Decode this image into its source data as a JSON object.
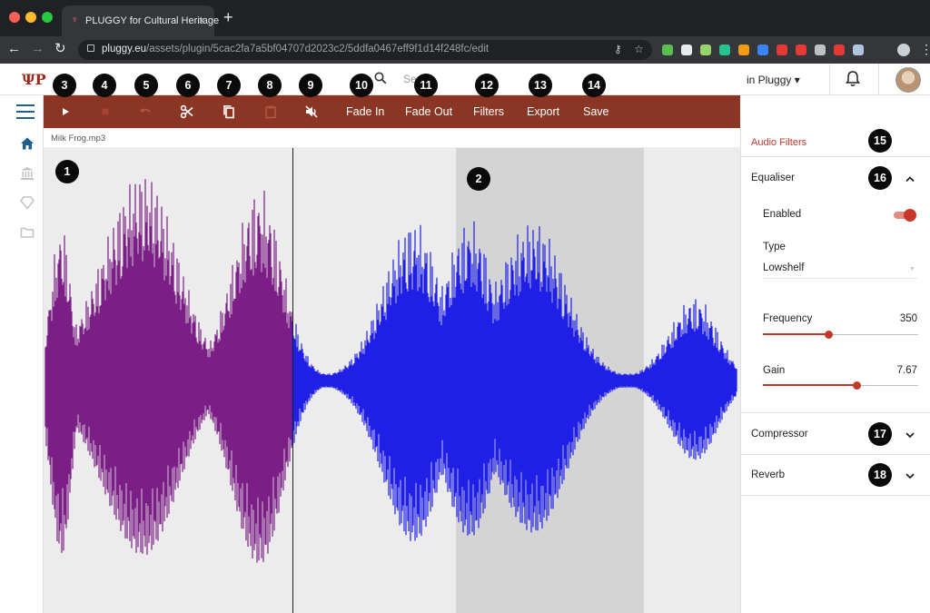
{
  "browser": {
    "tab_title": "PLUGGY for Cultural Heritage",
    "tab_close": "×",
    "new_tab": "+",
    "url_host": "pluggy.eu",
    "url_path": "/assets/plugin/5cac2fa7a5bf04707d2023c2/5ddfa0467eff9f1d14f248fc/edit",
    "extension_colors": [
      "#5abf4c",
      "#e8eaed",
      "#9ad26e",
      "#27c38e",
      "#f39c12",
      "#3b82f6",
      "#e53935",
      "#e53935",
      "#bdc1c6",
      "#e53935",
      "#b0c4de"
    ]
  },
  "header": {
    "search_placeholder": "Se",
    "language_label": "in Pluggy ▾"
  },
  "toolbar": {
    "fade_in": "Fade In",
    "fade_out": "Fade Out",
    "filters": "Filters",
    "export": "Export",
    "save": "Save",
    "color": "#8b3524"
  },
  "markers": [
    "1",
    "2",
    "3",
    "4",
    "5",
    "6",
    "7",
    "8",
    "9",
    "10",
    "11",
    "12",
    "13",
    "14",
    "15",
    "16",
    "17",
    "18"
  ],
  "editor": {
    "file_name": "Milk Frog.mp3",
    "played_color": "#7b1e85",
    "unplayed_color": "#1f1fe8",
    "selection_color": "#d4d4d4"
  },
  "filters": {
    "title": "Audio Filters",
    "equaliser": {
      "label": "Equaliser",
      "enabled_label": "Enabled",
      "enabled": true,
      "type_label": "Type",
      "type_value": "Lowshelf",
      "frequency_label": "Frequency",
      "frequency_value": "350",
      "frequency_fraction": 0.42,
      "gain_label": "Gain",
      "gain_value": "7.67",
      "gain_fraction": 0.6
    },
    "compressor_label": "Compressor",
    "reverb_label": "Reverb"
  }
}
